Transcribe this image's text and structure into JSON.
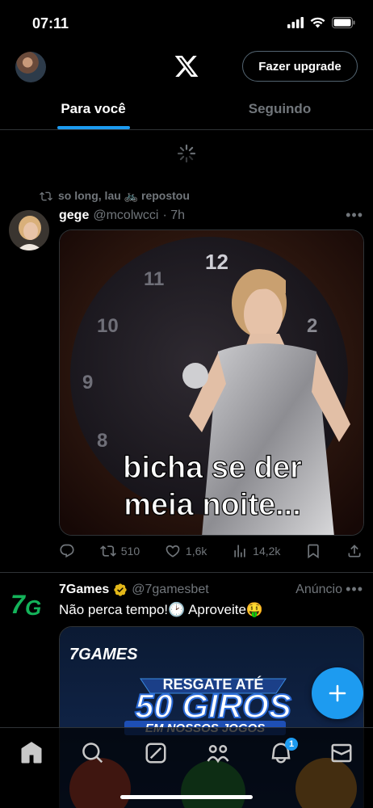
{
  "status_bar": {
    "time": "07:11"
  },
  "header": {
    "upgrade_label": "Fazer upgrade"
  },
  "tabs": [
    {
      "label": "Para você",
      "active": true
    },
    {
      "label": "Seguindo",
      "active": false
    }
  ],
  "tweets": [
    {
      "repost_by": "so long, lau 🚲 repostou",
      "name": "gege",
      "handle": "@mcolwcci",
      "time": "· 7h",
      "media_caption_line1": "bicha se der",
      "media_caption_line2": "meia noite...",
      "clock_numbers": [
        "12",
        "11",
        "10",
        "9",
        "8",
        "2"
      ],
      "stats": {
        "reposts": "510",
        "likes": "1,6k",
        "views": "14,2k"
      }
    },
    {
      "name": "7Games",
      "handle": "@7gamesbet",
      "ad_label": "Anúncio",
      "text": "Não perca tempo!🕑 Aproveite🤑",
      "banner": {
        "logo": "7GAMES",
        "line1": "RESGATE ATÉ",
        "line2": "50 GIROS",
        "line3": "EM NOSSOS JOGOS"
      }
    }
  ],
  "bottom_nav": {
    "notification_count": "1"
  },
  "colors": {
    "accent": "#1d9bf0",
    "background": "#000000",
    "muted": "#71767b"
  }
}
